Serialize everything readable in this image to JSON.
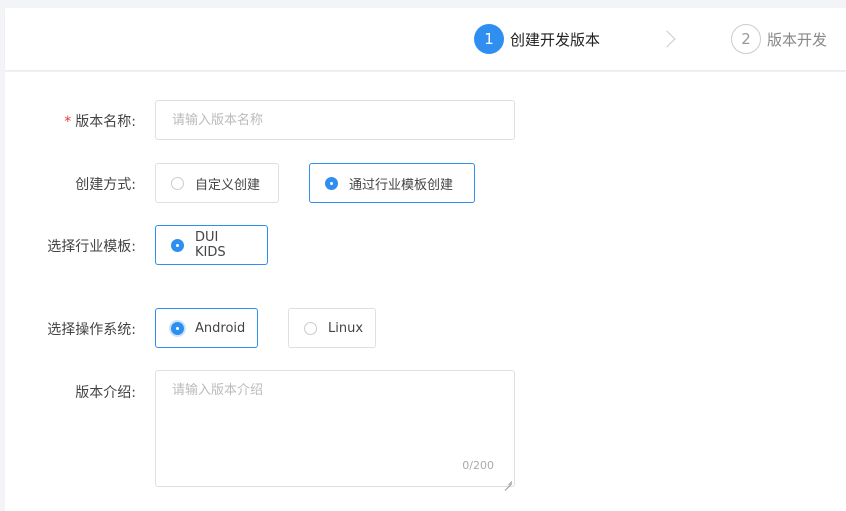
{
  "steps": [
    {
      "number": "1",
      "label": "创建开发版本",
      "state": "active"
    },
    {
      "number": "2",
      "label": "版本开发",
      "state": "inactive"
    }
  ],
  "form": {
    "version_name": {
      "required_mark": "*",
      "label": "版本名称:",
      "placeholder": "请输入版本名称",
      "value": ""
    },
    "create_method": {
      "label": "创建方式:",
      "options": [
        {
          "label": "自定义创建",
          "selected": false
        },
        {
          "label": "通过行业模板创建",
          "selected": true
        }
      ]
    },
    "industry_template": {
      "label": "选择行业模板:",
      "options": [
        {
          "label": "DUI KIDS",
          "selected": true
        }
      ]
    },
    "operating_system": {
      "label": "选择操作系统:",
      "options": [
        {
          "label": "Android",
          "selected": true
        },
        {
          "label": "Linux",
          "selected": false
        }
      ]
    },
    "version_intro": {
      "label": "版本介绍:",
      "placeholder": "请输入版本介绍",
      "value": "",
      "counter": "0/200"
    }
  },
  "colors": {
    "accent": "#2f8ff0",
    "required": "#e53935",
    "border": "#dcdfe6"
  }
}
